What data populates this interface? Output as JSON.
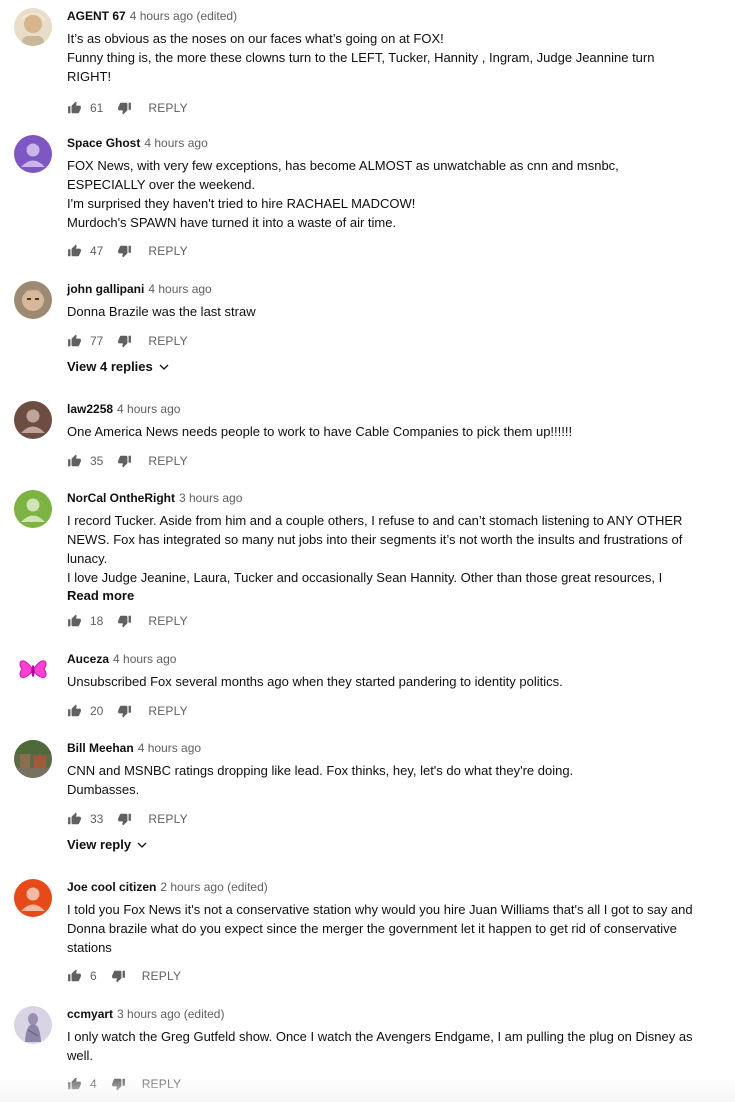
{
  "comments": [
    {
      "author": "AGENT 67",
      "time": "4 hours ago (edited)",
      "text": "It’s as obvious as the noses on our faces what’s going on at FOX!\nFunny thing is, the more these clowns turn to the LEFT, Tucker, Hannity , Ingram, Judge Jeannine turn RIGHT!",
      "likes": "61",
      "reply_label": "REPLY",
      "avatar_color": "#e9dcc8"
    },
    {
      "author": "Space Ghost",
      "time": "4 hours ago",
      "text": "FOX News, with very few exceptions, has become ALMOST as unwatchable as cnn and msnbc, ESPECIALLY over the weekend.\nI'm surprised they haven't tried to hire RACHAEL MADCOW!\nMurdoch's SPAWN have turned it into a waste of air time.",
      "likes": "47",
      "reply_label": "REPLY",
      "avatar_color": "#7e57c2"
    },
    {
      "author": "john gallipani",
      "time": "4 hours ago",
      "text": "Donna Brazile was the last straw",
      "likes": "77",
      "reply_label": "REPLY",
      "view_replies": "View 4 replies",
      "avatar_color": "#b89a7c"
    },
    {
      "author": "law2258",
      "time": "4 hours ago",
      "text": "One America News needs people to work to have Cable Companies to pick them up!!!!!!",
      "likes": "35",
      "reply_label": "REPLY",
      "avatar_color": "#6d4c41"
    },
    {
      "author": "NorCal OntheRight",
      "time": "3 hours ago",
      "text": "I record Tucker. Aside from him and a couple others, I refuse to and can’t stomach listening to ANY OTHER NEWS. Fox has integrated so many nut jobs into their segments it’s not worth the insults and frustrations of lunacy.\nI love Judge Jeanine, Laura, Tucker and occasionally Sean Hannity. Other than those great resources, I",
      "read_more": "Read more",
      "likes": "18",
      "reply_label": "REPLY",
      "avatar_color": "#7cb342"
    },
    {
      "author": "Auceza",
      "time": "4 hours ago",
      "text": "Unsubscribed Fox several months ago when they started pandering to identity politics.",
      "likes": "20",
      "reply_label": "REPLY",
      "avatar_color": "#ff40d0"
    },
    {
      "author": "Bill Meehan",
      "time": "4 hours ago",
      "text": "CNN and MSNBC ratings dropping like lead. Fox thinks, hey, let's do what they're doing.\nDumbasses.",
      "likes": "33",
      "reply_label": "REPLY",
      "view_replies": "View reply",
      "avatar_color": "#5d6b4a"
    },
    {
      "author": "Joe cool citizen",
      "time": "2 hours ago (edited)",
      "text": "I told you Fox News it's not a conservative station why would you hire Juan Williams that's all I got to say and Donna brazile what do you expect since the merger the government let it happen to get rid of conservative stations",
      "likes": "6",
      "reply_label": "REPLY",
      "avatar_color": "#e64a19"
    },
    {
      "author": "ccmyart",
      "time": "3 hours ago (edited)",
      "text": "I only watch the Greg Gutfeld show. Once I watch the Avengers Endgame, I am pulling the plug on Disney as well.",
      "likes": "4",
      "reply_label": "REPLY",
      "avatar_color": "#d9d4e4"
    }
  ]
}
